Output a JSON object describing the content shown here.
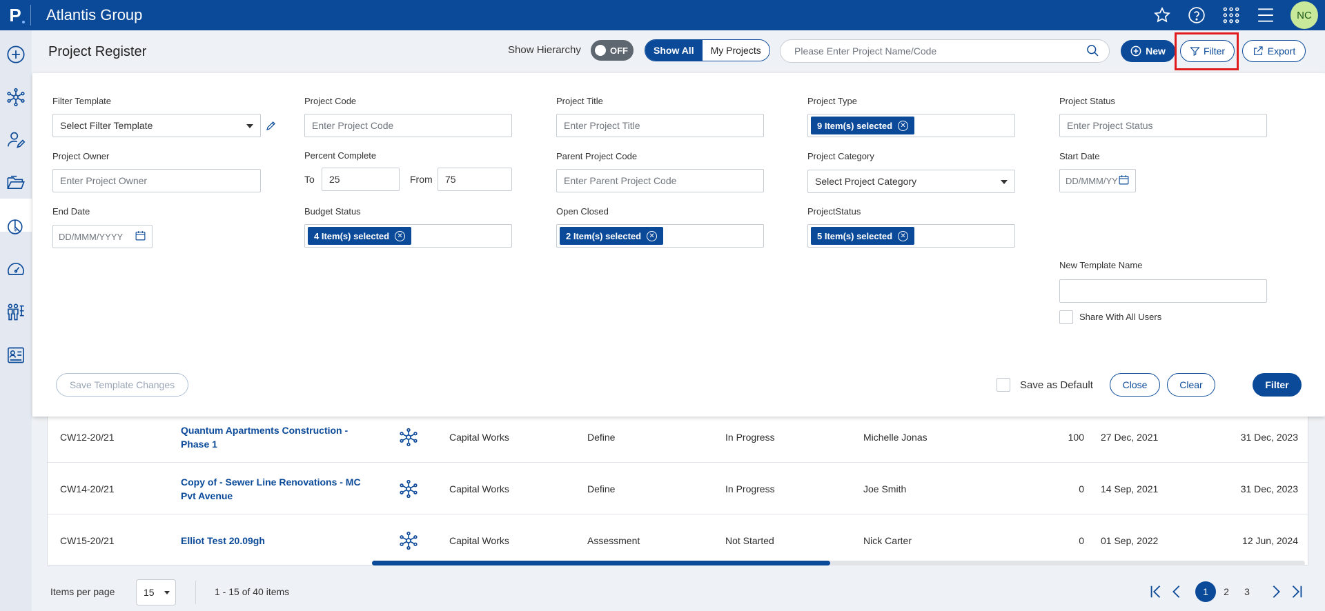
{
  "header": {
    "logo_letter": "P",
    "app_title": "Atlantis Group",
    "user_initials": "NC",
    "icons": [
      "star-icon",
      "help-icon",
      "apps-grid-icon",
      "hamburger-menu-icon"
    ]
  },
  "sidebar": {
    "icons": [
      "add-circle-icon",
      "network-icon",
      "user-edit-icon",
      "folder-open-icon",
      "finance-icon",
      "dashboard-gauge-icon",
      "org-chart-icon",
      "report-card-icon"
    ]
  },
  "toolbar": {
    "page_title": "Project Register",
    "show_hierarchy_label": "Show Hierarchy",
    "toggle_state": "OFF",
    "show_all_label": "Show All",
    "my_projects_label": "My Projects",
    "search_placeholder": "Please Enter Project Name/Code",
    "new_label": "New",
    "filter_label": "Filter",
    "export_label": "Export"
  },
  "filter_panel": {
    "filter_template": {
      "label": "Filter Template",
      "value": "Select Filter Template"
    },
    "project_code": {
      "label": "Project Code",
      "placeholder": "Enter Project Code"
    },
    "project_title": {
      "label": "Project Title",
      "placeholder": "Enter Project Title"
    },
    "project_type": {
      "label": "Project Type",
      "chip": "9 Item(s) selected"
    },
    "project_status": {
      "label": "Project Status",
      "placeholder": "Enter Project Status"
    },
    "project_owner": {
      "label": "Project Owner",
      "placeholder": "Enter Project Owner"
    },
    "percent_complete": {
      "label": "Percent Complete",
      "to_label": "To",
      "to_value": "25",
      "from_label": "From",
      "from_value": "75"
    },
    "parent_project_code": {
      "label": "Parent Project Code",
      "placeholder": "Enter Parent Project Code"
    },
    "project_category": {
      "label": "Project Category",
      "value": "Select Project Category"
    },
    "start_date": {
      "label": "Start Date",
      "placeholder": "DD/MMM/YYYY"
    },
    "end_date": {
      "label": "End Date",
      "placeholder": "DD/MMM/YYYY"
    },
    "budget_status": {
      "label": "Budget Status",
      "chip": "4 Item(s) selected"
    },
    "open_closed": {
      "label": "Open Closed",
      "chip": "2 Item(s) selected"
    },
    "projectstatus": {
      "label": "ProjectStatus",
      "chip": "5 Item(s) selected"
    },
    "new_template_name": {
      "label": "New Template Name",
      "value": ""
    },
    "share_label": "Share With All Users",
    "save_template_label": "Save Template Changes",
    "save_default_label": "Save as Default",
    "close_label": "Close",
    "clear_label": "Clear",
    "filter_label": "Filter"
  },
  "table": {
    "rows": [
      {
        "code": "CW12-20/21",
        "title_line1": "Quantum Apartments Construction -",
        "title_line2": "Phase 1",
        "type": "Capital Works",
        "phase": "Define",
        "status": "In Progress",
        "owner": "Michelle Jonas",
        "percent": "100",
        "start": "27 Dec, 2021",
        "end": "31 Dec, 2023"
      },
      {
        "code": "CW14-20/21",
        "title_line1": "Copy of - Sewer Line Renovations - MC",
        "title_line2": "Pvt Avenue",
        "type": "Capital Works",
        "phase": "Define",
        "status": "In Progress",
        "owner": "Joe Smith",
        "percent": "0",
        "start": "14 Sep, 2021",
        "end": "31 Dec, 2023"
      },
      {
        "code": "CW15-20/21",
        "title_line1": "Elliot Test 20.09gh",
        "title_line2": "",
        "type": "Capital Works",
        "phase": "Assessment",
        "status": "Not Started",
        "owner": "Nick Carter",
        "percent": "0",
        "start": "01 Sep, 2022",
        "end": "12 Jun, 2024"
      }
    ]
  },
  "footer": {
    "items_per_page_label": "Items per page",
    "items_per_page_value": "15",
    "range_text": "1 - 15 of 40 items",
    "pages": [
      "1",
      "2",
      "3"
    ],
    "current_page": "1"
  },
  "colors": {
    "brand": "#0b4a99",
    "highlight": "#e01b1b",
    "avatar": "#c9e99a"
  }
}
